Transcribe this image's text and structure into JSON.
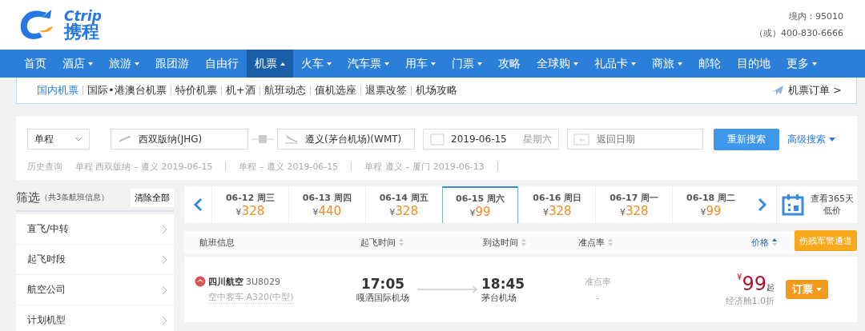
{
  "logo": {
    "brand": "Ctrip",
    "name": "携程"
  },
  "hotline": {
    "domestic": "境内：95010",
    "other": "（或）400-830-6666"
  },
  "nav": [
    {
      "label": "首页",
      "dropdown": false,
      "selected": false
    },
    {
      "label": "酒店",
      "dropdown": true,
      "selected": false
    },
    {
      "label": "旅游",
      "dropdown": true,
      "selected": false
    },
    {
      "label": "跟团游",
      "dropdown": false,
      "selected": false
    },
    {
      "label": "自由行",
      "dropdown": false,
      "selected": false
    },
    {
      "label": "机票",
      "dropdown": true,
      "selected": true
    },
    {
      "label": "火车",
      "dropdown": true,
      "selected": false
    },
    {
      "label": "汽车票",
      "dropdown": true,
      "selected": false
    },
    {
      "label": "用车",
      "dropdown": true,
      "selected": false
    },
    {
      "label": "门票",
      "dropdown": true,
      "selected": false
    },
    {
      "label": "攻略",
      "dropdown": false,
      "selected": false
    },
    {
      "label": "全球购",
      "dropdown": true,
      "selected": false
    },
    {
      "label": "礼品卡",
      "dropdown": true,
      "selected": false
    },
    {
      "label": "商旅",
      "dropdown": true,
      "selected": false
    },
    {
      "label": "邮轮",
      "dropdown": false,
      "selected": false
    },
    {
      "label": "目的地",
      "dropdown": false,
      "selected": false
    },
    {
      "label": "更多",
      "dropdown": true,
      "selected": false
    }
  ],
  "subnav": {
    "items": [
      {
        "label": "国内机票",
        "selected": true
      },
      {
        "label": "国际•港澳台机票",
        "selected": false
      },
      {
        "label": "特价机票",
        "selected": false
      },
      {
        "label": "机+酒",
        "selected": false
      },
      {
        "label": "航班动态",
        "selected": false
      },
      {
        "label": "值机选座",
        "selected": false
      },
      {
        "label": "退票改签",
        "selected": false
      },
      {
        "label": "机场攻略",
        "selected": false
      }
    ],
    "orders": "机票订单 >"
  },
  "search": {
    "trip_type": "单程",
    "from": "西双版纳(JHG)",
    "to": "遵义(茅台机场)(WMT)",
    "date": "2019-06-15",
    "weekday": "星期六",
    "return_placeholder": "返回日期",
    "button": "重新搜索",
    "advanced": "高级搜索"
  },
  "history": {
    "label": "历史查询",
    "items": [
      "单程 西双版纳 – 遵义 2019-06-15",
      "单程 – 遵义 2019-06-15",
      "单程 遵义 – 厦门 2019-06-13"
    ]
  },
  "filter": {
    "title": "筛选",
    "count": "（共3条航班信息）",
    "clear": "清除全部",
    "items": [
      "直飞/中转",
      "起飞时段",
      "航空公司",
      "计划机型"
    ]
  },
  "dates": [
    {
      "date": "06-12 周三",
      "currency": "¥",
      "price": "328",
      "selected": false
    },
    {
      "date": "06-13 周四",
      "currency": "¥",
      "price": "440",
      "selected": false
    },
    {
      "date": "06-14 周五",
      "currency": "¥",
      "price": "328",
      "selected": false
    },
    {
      "date": "06-15 周六",
      "currency": "¥",
      "price": "99",
      "selected": true
    },
    {
      "date": "06-16 周日",
      "currency": "¥",
      "price": "328",
      "selected": false
    },
    {
      "date": "06-17 周一",
      "currency": "¥",
      "price": "328",
      "selected": false
    },
    {
      "date": "06-18 周二",
      "currency": "¥",
      "price": "99",
      "selected": false
    }
  ],
  "calendar": {
    "line1": "查看365天",
    "line2": "低价"
  },
  "table": {
    "columns": [
      {
        "label": "航班信息",
        "sortable": false,
        "selected": false
      },
      {
        "label": "起飞时间",
        "sortable": true,
        "selected": false
      },
      {
        "label": "到达时间",
        "sortable": true,
        "selected": false
      },
      {
        "label": "准点率",
        "sortable": true,
        "selected": false
      },
      {
        "label": "价格",
        "sortable": true,
        "selected": true
      }
    ],
    "special_button": "伤残军警通道",
    "rows": [
      {
        "airline": "四川航空",
        "flight_no": "3U8029",
        "aircraft": "空中客车 A320(中型)",
        "dep_time": "17:05",
        "dep_airport": "嘎洒国际机场",
        "arr_time": "18:45",
        "arr_airport": "茅台机场",
        "punctuality_label": "准点率",
        "punctuality": "-",
        "currency": "¥",
        "price": "99",
        "price_suffix": "起",
        "cabin": "经济舱1.0折",
        "book": "订票"
      }
    ]
  }
}
